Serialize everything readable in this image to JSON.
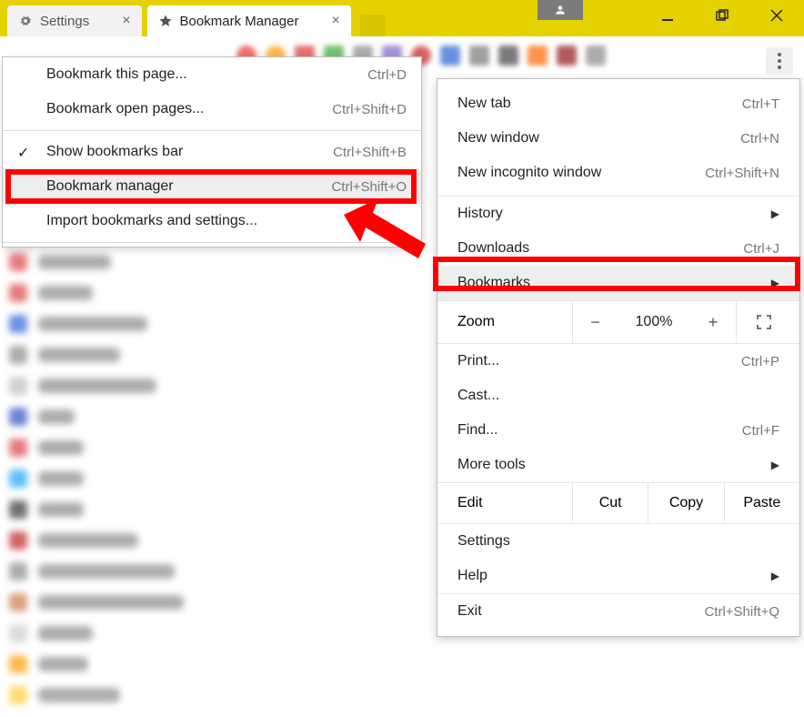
{
  "titlebar": {
    "tabs": [
      {
        "label": "Settings",
        "active": false
      },
      {
        "label": "Bookmark Manager",
        "active": true
      }
    ]
  },
  "bookmarks_submenu": {
    "items": [
      {
        "label": "Bookmark this page...",
        "shortcut": "Ctrl+D"
      },
      {
        "label": "Bookmark open pages...",
        "shortcut": "Ctrl+Shift+D"
      },
      {
        "label": "Show bookmarks bar",
        "shortcut": "Ctrl+Shift+B",
        "checked": true
      },
      {
        "label": "Bookmark manager",
        "shortcut": "Ctrl+Shift+O",
        "highlighted": true
      },
      {
        "label": "Import bookmarks and settings..."
      }
    ]
  },
  "main_menu": {
    "group1": [
      {
        "label": "New tab",
        "shortcut": "Ctrl+T"
      },
      {
        "label": "New window",
        "shortcut": "Ctrl+N"
      },
      {
        "label": "New incognito window",
        "shortcut": "Ctrl+Shift+N"
      }
    ],
    "group2": [
      {
        "label": "History",
        "arrow": true
      },
      {
        "label": "Downloads",
        "shortcut": "Ctrl+J"
      },
      {
        "label": "Bookmarks",
        "arrow": true,
        "highlighted": true
      }
    ],
    "zoom": {
      "label": "Zoom",
      "value": "100%",
      "minus": "−",
      "plus": "+"
    },
    "group3": [
      {
        "label": "Print...",
        "shortcut": "Ctrl+P"
      },
      {
        "label": "Cast..."
      },
      {
        "label": "Find...",
        "shortcut": "Ctrl+F"
      },
      {
        "label": "More tools",
        "arrow": true
      }
    ],
    "edit": {
      "label": "Edit",
      "cut": "Cut",
      "copy": "Copy",
      "paste": "Paste"
    },
    "group4": [
      {
        "label": "Settings"
      },
      {
        "label": "Help",
        "arrow": true
      }
    ],
    "group5": [
      {
        "label": "Exit",
        "shortcut": "Ctrl+Shift+Q"
      }
    ]
  }
}
